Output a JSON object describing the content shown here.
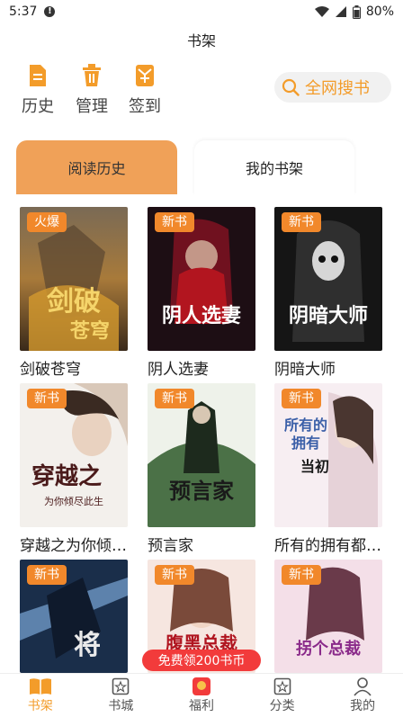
{
  "status": {
    "time": "5:37",
    "battery": "80%"
  },
  "header": {
    "title": "书架"
  },
  "quick_actions": [
    {
      "label": "历史",
      "icon": "history-doc-icon"
    },
    {
      "label": "管理",
      "icon": "trash-icon"
    },
    {
      "label": "签到",
      "icon": "checkin-icon"
    }
  ],
  "search": {
    "label": "全网搜书",
    "icon": "search-icon"
  },
  "tabs": {
    "history": "阅读历史",
    "shelf": "我的书架"
  },
  "books": [
    {
      "title": "剑破苍穹",
      "badge": "火爆"
    },
    {
      "title": "阴人选妻",
      "badge": "新书"
    },
    {
      "title": "阴暗大师",
      "badge": "新书"
    },
    {
      "title": "穿越之为你倾…",
      "badge": "新书"
    },
    {
      "title": "预言家",
      "badge": "新书"
    },
    {
      "title": "所有的拥有都…",
      "badge": "新书"
    },
    {
      "title": "",
      "badge": "新书"
    },
    {
      "title": "",
      "badge": "新书"
    },
    {
      "title": "",
      "badge": "新书"
    }
  ],
  "promo": {
    "label": "免费领200书币"
  },
  "nav": [
    {
      "label": "书架",
      "icon": "bookshelf-icon"
    },
    {
      "label": "书城",
      "icon": "bookstore-icon"
    },
    {
      "label": "福利",
      "icon": "gift-icon"
    },
    {
      "label": "分类",
      "icon": "category-icon"
    },
    {
      "label": "我的",
      "icon": "profile-icon"
    }
  ],
  "colors": {
    "accent": "#f39c2a",
    "badge": "#f1882b",
    "promo": "#f23b3b",
    "tab_active": "#f0a158"
  }
}
